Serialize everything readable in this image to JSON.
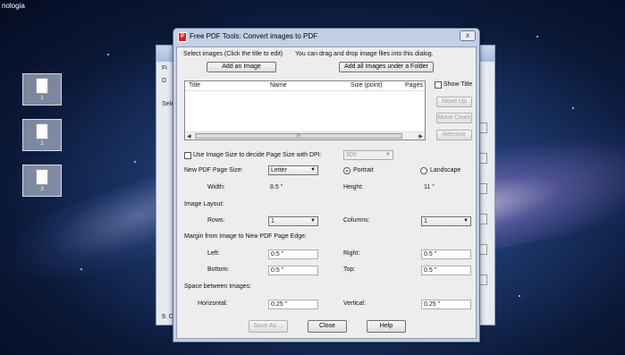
{
  "desktop": {
    "top_title": "nologia",
    "icons": [
      {
        "label": "1"
      },
      {
        "label": "2"
      },
      {
        "label": "3"
      }
    ]
  },
  "bg_window": {
    "tab_fragment": "Fi",
    "tool_fragment": "D",
    "select_fragment": "Sele",
    "status_fragment": "9. Co"
  },
  "dialog": {
    "title": "Free PDF Tools: Convert images to PDF",
    "close_glyph": "x",
    "select_images_label": "Select images (Click the title to edit)",
    "drag_hint": "You can drag and drop image files into this dialog.",
    "add_image_label": "Add an Image",
    "add_folder_label": "Add all Images under a Folder",
    "list_columns": [
      "Title",
      "Name",
      "Size (point)",
      "Pages"
    ],
    "scroll_thumb": "III",
    "show_title_label": "Show Title",
    "move_up_label": "Move Up",
    "move_down_label": "Move Down",
    "remove_label": "Remove",
    "use_image_size_label": "Use Image Size to decide Page Size with DPI:",
    "dpi_value": "300",
    "page_size_label": "New PDF Page Size:",
    "page_size_value": "Letter",
    "portrait_label": "Portrait",
    "landscape_label": "Landscape",
    "width_label": "Width:",
    "width_value": "8.5 ''",
    "height_label": "Height:",
    "height_value": "11 ''",
    "image_layout_label": "Image Layout:",
    "rows_label": "Rows:",
    "rows_value": "1",
    "columns_label": "Columns:",
    "columns_value": "1",
    "margin_label": "Margin from Image to New PDF Page Edge:",
    "left_label": "Left:",
    "left_value": "0.5 ''",
    "right_label": "Right:",
    "right_value": "0.5 ''",
    "bottom_label": "Bottom:",
    "bottom_value": "0.5 ''",
    "top_label": "Top:",
    "top_value": "0.5 ''",
    "space_label": "Space between Images:",
    "horizontal_label": "Horizontal:",
    "horizontal_value": "0.25 ''",
    "vertical_label": "Vertical:",
    "vertical_value": "0.25 ''",
    "save_as_label": "Save As ...",
    "close_label": "Close",
    "help_label": "Help"
  }
}
